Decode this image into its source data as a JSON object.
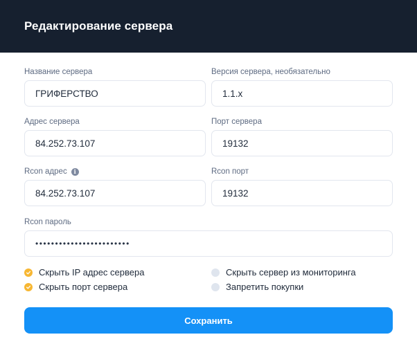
{
  "header": {
    "title": "Редактирование сервера"
  },
  "fields": {
    "server_name": {
      "label": "Название сервера",
      "value": "ГРИФЕРСТВО"
    },
    "server_version": {
      "label": "Версия сервера, необязательно",
      "value": "1.1.x"
    },
    "server_address": {
      "label": "Адрес сервера",
      "value": "84.252.73.107"
    },
    "server_port": {
      "label": "Порт сервера",
      "value": "19132"
    },
    "rcon_address": {
      "label": "Rcon адрес",
      "value": "84.252.73.107"
    },
    "rcon_port": {
      "label": "Rcon порт",
      "value": "19132"
    },
    "rcon_password": {
      "label": "Rcon пароль",
      "value": "••••••••••••••••••••••••"
    }
  },
  "checkboxes": {
    "hide_ip": {
      "label": "Скрыть IP адрес сервера",
      "checked": true
    },
    "hide_port": {
      "label": "Скрыть порт сервера",
      "checked": true
    },
    "hide_from_monitoring": {
      "label": "Скрыть сервер из мониторинга",
      "checked": false
    },
    "forbid_purchases": {
      "label": "Запретить покупки",
      "checked": false
    }
  },
  "save_button": {
    "label": "Сохранить"
  },
  "colors": {
    "header_bg": "#16202f",
    "accent": "#1491f7",
    "checked": "#f7b733",
    "unchecked": "#dfe5ee"
  }
}
